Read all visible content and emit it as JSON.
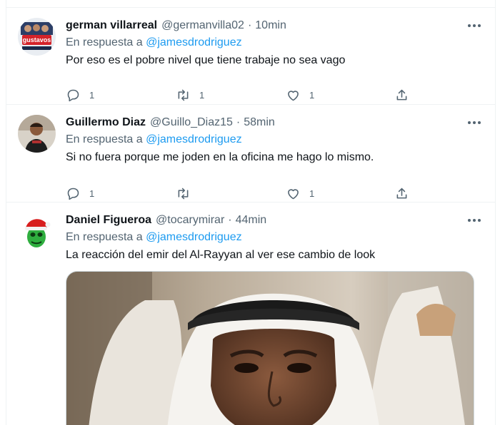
{
  "tweets": [
    {
      "name": "german villarreal",
      "handle": "@germanvilla02",
      "separator": "·",
      "time": "10min",
      "reply_prefix": "En respuesta a",
      "reply_to": "@jamesdrodriguez",
      "text": "Por eso es el pobre nivel que tiene trabaje no sea vago",
      "avatar_text": "gustavos",
      "reply_count": "1",
      "retweet_count": "1",
      "like_count": "1"
    },
    {
      "name": "Guillermo Diaz",
      "handle": "@Guillo_Diaz15",
      "separator": "·",
      "time": "58min",
      "reply_prefix": "En respuesta a",
      "reply_to": "@jamesdrodriguez",
      "text": "Si no fuera porque me joden en la oficina me hago lo mismo.",
      "reply_count": "1",
      "retweet_count": "",
      "like_count": "1"
    },
    {
      "name": "Daniel Figueroa",
      "handle": "@tocarymirar",
      "separator": "·",
      "time": "44min",
      "reply_prefix": "En respuesta a",
      "reply_to": "@jamesdrodriguez",
      "text": "La reacción del emir del Al-Rayyan al ver ese cambio de look"
    }
  ],
  "colors": {
    "link": "#1d9bf0",
    "secondary_text": "#536471",
    "border": "#eff3f4"
  },
  "icons": [
    "reply-icon",
    "retweet-icon",
    "like-icon",
    "share-icon",
    "more-icon"
  ]
}
